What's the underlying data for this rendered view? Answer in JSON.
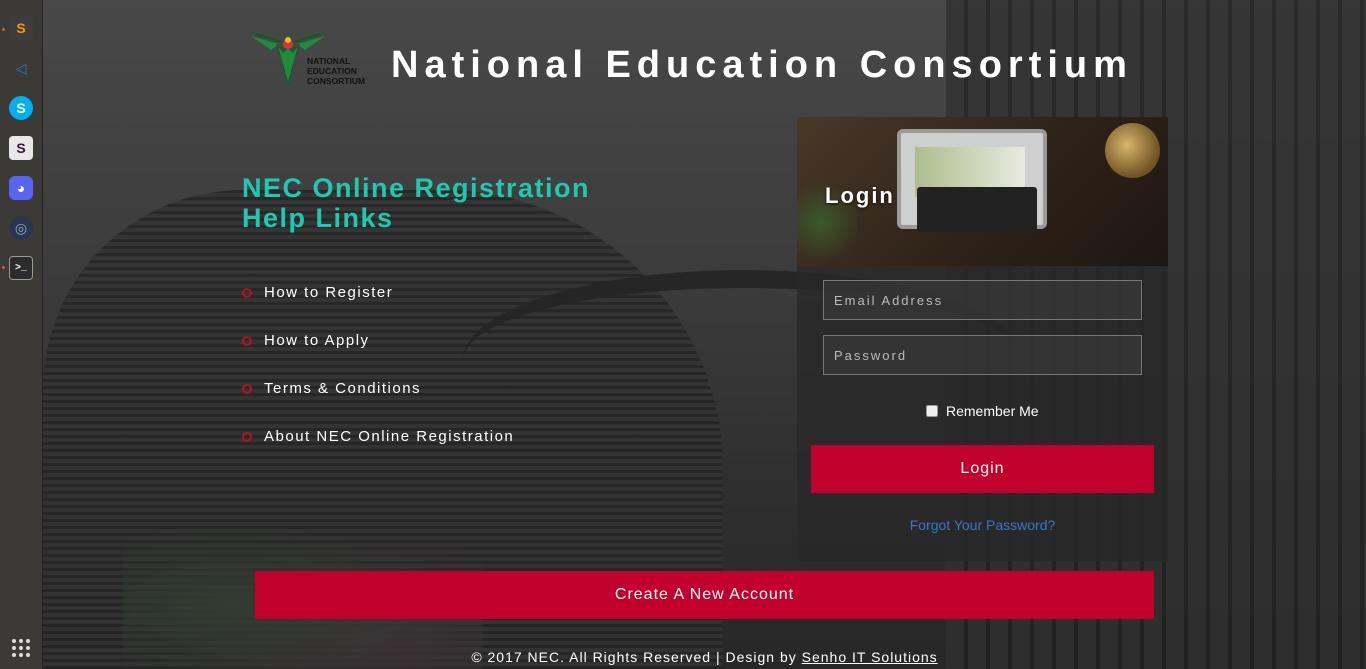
{
  "dock": {
    "items": [
      {
        "name": "sublime-text-icon",
        "glyph": "S",
        "color": "#ff9800"
      },
      {
        "name": "vscode-icon",
        "glyph": "◁",
        "color": "#2b7bd6"
      },
      {
        "name": "skype-icon",
        "glyph": "S",
        "color": "#00aff0"
      },
      {
        "name": "slack-icon",
        "glyph": "S",
        "color": "#e8e8e8"
      },
      {
        "name": "discord-icon",
        "glyph": "◕",
        "color": "#5865f2"
      },
      {
        "name": "gnome-disk-icon",
        "glyph": "◎",
        "color": "#2a3550"
      },
      {
        "name": "terminal-icon",
        "glyph": ">_",
        "color": "#2b2b2b"
      }
    ]
  },
  "header": {
    "logo_lines": [
      "NATIONAL",
      "EDUCATION",
      "CONSORTIUM"
    ],
    "title": "National Education Consortium"
  },
  "help": {
    "title": "NEC Online Registration Help Links",
    "links": [
      "How to Register",
      "How to Apply",
      "Terms & Conditions",
      "About NEC Online Registration"
    ]
  },
  "login": {
    "heading": "Login",
    "email_placeholder": "Email Address",
    "password_placeholder": "Password",
    "remember_label": "Remember Me",
    "submit_label": "Login",
    "forgot_label": "Forgot Your Password?"
  },
  "create_account_label": "Create A New Account",
  "footer": {
    "text": "© 2017 NEC. All Rights Reserved | Design by ",
    "link": "Senho IT Solutions"
  },
  "colors": {
    "accent": "#c1002c",
    "help_title": "#1ec9b0",
    "forgot_link": "#3b74c9"
  }
}
